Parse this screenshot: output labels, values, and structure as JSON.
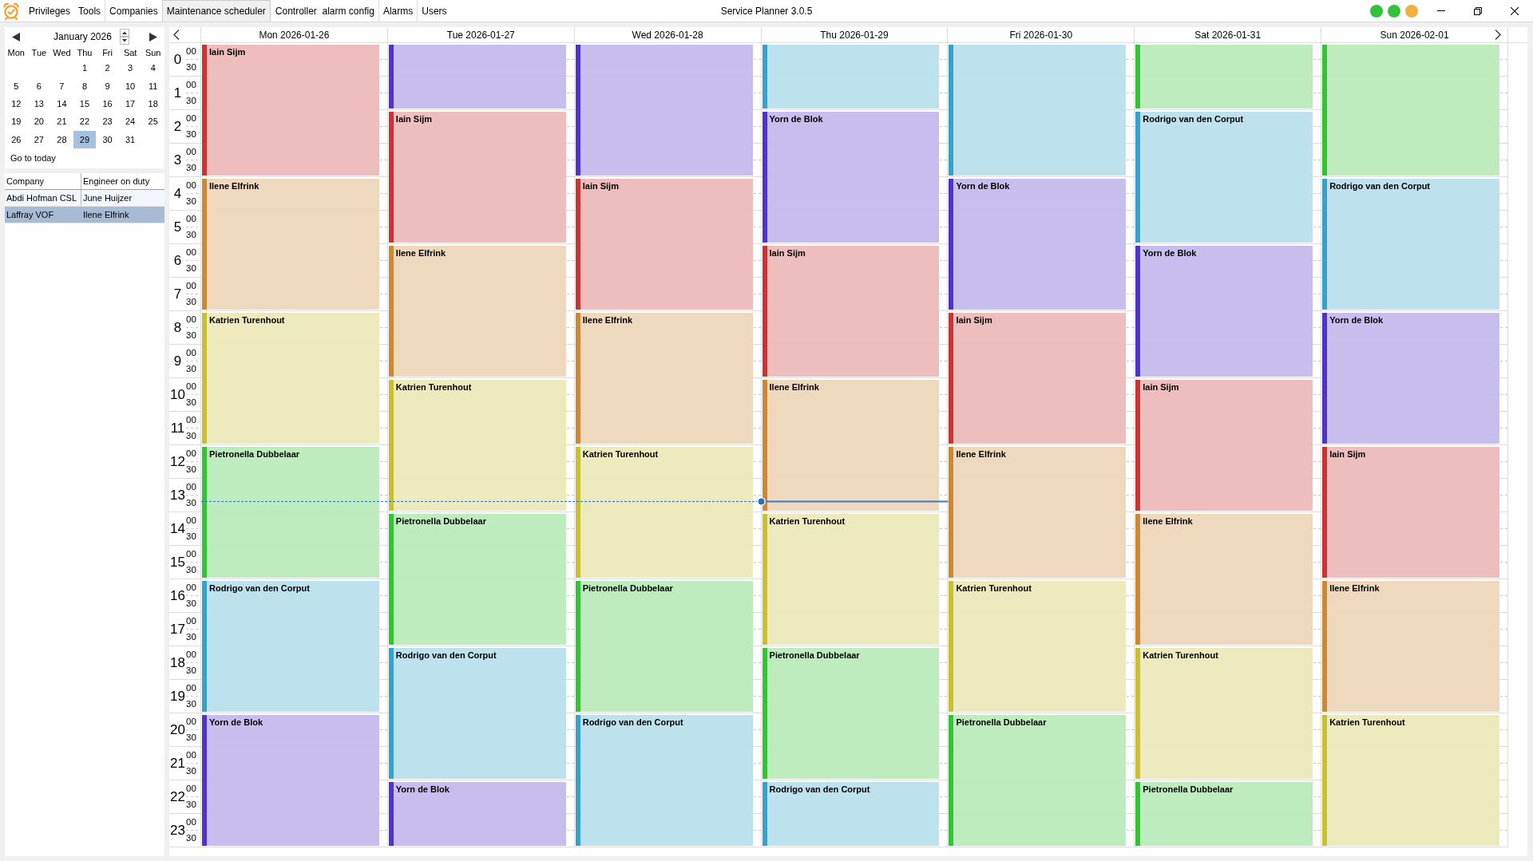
{
  "app": {
    "menu": [
      "Privileges",
      "Tools"
    ],
    "tabs": [
      {
        "label": "Companies",
        "selected": false
      },
      {
        "label": "Maintenance scheduler",
        "selected": true
      },
      {
        "label": "Controller  alarm config",
        "selected": false
      },
      {
        "label": "Alarms",
        "selected": false
      },
      {
        "label": "Users",
        "selected": false
      }
    ],
    "title": "Service Planner 3.0.5",
    "status_lights": [
      {
        "color": "#34c23e"
      },
      {
        "color": "#34c23e"
      },
      {
        "color": "#f2b040"
      }
    ]
  },
  "mini_calendar": {
    "month": "January 2026",
    "weekdays": [
      "Mon",
      "Tue",
      "Wed",
      "Thu",
      "Fri",
      "Sat",
      "Sun"
    ],
    "weeks": [
      [
        {
          "label": "1",
          "selected": false
        },
        {
          "label": "2",
          "selected": false
        },
        {
          "label": "3",
          "selected": false
        },
        {
          "label": "4",
          "selected": false
        }
      ],
      [
        {
          "label": "5",
          "selected": false
        },
        {
          "label": "6",
          "selected": false
        },
        {
          "label": "7",
          "selected": false
        },
        {
          "label": "8",
          "selected": false
        },
        {
          "label": "9",
          "selected": false
        },
        {
          "label": "10",
          "selected": false
        },
        {
          "label": "11",
          "selected": false
        }
      ],
      [
        {
          "label": "12",
          "selected": false
        },
        {
          "label": "13",
          "selected": false
        },
        {
          "label": "14",
          "selected": false
        },
        {
          "label": "15",
          "selected": false
        },
        {
          "label": "16",
          "selected": false
        },
        {
          "label": "17",
          "selected": false
        },
        {
          "label": "18",
          "selected": false
        }
      ],
      [
        {
          "label": "19",
          "selected": false
        },
        {
          "label": "20",
          "selected": false
        },
        {
          "label": "21",
          "selected": false
        },
        {
          "label": "22",
          "selected": false
        },
        {
          "label": "23",
          "selected": false
        },
        {
          "label": "24",
          "selected": false
        },
        {
          "label": "25",
          "selected": false
        }
      ],
      [
        {
          "label": "26",
          "selected": false
        },
        {
          "label": "27",
          "selected": false
        },
        {
          "label": "28",
          "selected": false
        },
        {
          "label": "29",
          "selected": true
        },
        {
          "label": "30",
          "selected": false
        },
        {
          "label": "31",
          "selected": false
        }
      ]
    ],
    "go_to_today": "Go to today"
  },
  "company_table": {
    "columns": [
      "Company",
      "Engineer on duty"
    ],
    "rows": [
      {
        "cells": [
          "Abdi Hofman CSL",
          "June Huijzer"
        ],
        "selected": false
      },
      {
        "cells": [
          "Laffray VOF",
          "Ilene Elfrink"
        ],
        "selected": true
      }
    ]
  },
  "week_view": {
    "hours": [
      {
        "hour": "0",
        "minutes": [
          {
            "label": "00",
            "now": false
          },
          {
            "label": "30",
            "now": false
          }
        ]
      },
      {
        "hour": "1",
        "minutes": [
          {
            "label": "00",
            "now": false
          },
          {
            "label": "30",
            "now": false
          }
        ]
      },
      {
        "hour": "2",
        "minutes": [
          {
            "label": "00",
            "now": false
          },
          {
            "label": "30",
            "now": false
          }
        ]
      },
      {
        "hour": "3",
        "minutes": [
          {
            "label": "00",
            "now": false
          },
          {
            "label": "30",
            "now": false
          }
        ]
      },
      {
        "hour": "4",
        "minutes": [
          {
            "label": "00",
            "now": false
          },
          {
            "label": "30",
            "now": false
          }
        ]
      },
      {
        "hour": "5",
        "minutes": [
          {
            "label": "00",
            "now": false
          },
          {
            "label": "30",
            "now": false
          }
        ]
      },
      {
        "hour": "6",
        "minutes": [
          {
            "label": "00",
            "now": false
          },
          {
            "label": "30",
            "now": false
          }
        ]
      },
      {
        "hour": "7",
        "minutes": [
          {
            "label": "00",
            "now": false
          },
          {
            "label": "30",
            "now": false
          }
        ]
      },
      {
        "hour": "8",
        "minutes": [
          {
            "label": "00",
            "now": false
          },
          {
            "label": "30",
            "now": false
          }
        ]
      },
      {
        "hour": "9",
        "minutes": [
          {
            "label": "00",
            "now": false
          },
          {
            "label": "30",
            "now": false
          }
        ]
      },
      {
        "hour": "10",
        "minutes": [
          {
            "label": "00",
            "now": false
          },
          {
            "label": "30",
            "now": false
          }
        ]
      },
      {
        "hour": "11",
        "minutes": [
          {
            "label": "00",
            "now": false
          },
          {
            "label": "30",
            "now": false
          }
        ]
      },
      {
        "hour": "12",
        "minutes": [
          {
            "label": "00",
            "now": false
          },
          {
            "label": "30",
            "now": false
          }
        ]
      },
      {
        "hour": "13",
        "minutes": [
          {
            "label": "00",
            "now": false
          },
          {
            "label": "30",
            "now": true
          }
        ]
      },
      {
        "hour": "14",
        "minutes": [
          {
            "label": "00",
            "now": false
          },
          {
            "label": "30",
            "now": false
          }
        ]
      },
      {
        "hour": "15",
        "minutes": [
          {
            "label": "00",
            "now": false
          },
          {
            "label": "30",
            "now": false
          }
        ]
      },
      {
        "hour": "16",
        "minutes": [
          {
            "label": "00",
            "now": false
          },
          {
            "label": "30",
            "now": false
          }
        ]
      },
      {
        "hour": "17",
        "minutes": [
          {
            "label": "00",
            "now": false
          },
          {
            "label": "30",
            "now": false
          }
        ]
      },
      {
        "hour": "18",
        "minutes": [
          {
            "label": "00",
            "now": false
          },
          {
            "label": "30",
            "now": false
          }
        ]
      },
      {
        "hour": "19",
        "minutes": [
          {
            "label": "00",
            "now": false
          },
          {
            "label": "30",
            "now": false
          }
        ]
      },
      {
        "hour": "20",
        "minutes": [
          {
            "label": "00",
            "now": false
          },
          {
            "label": "30",
            "now": false
          }
        ]
      },
      {
        "hour": "21",
        "minutes": [
          {
            "label": "00",
            "now": false
          },
          {
            "label": "30",
            "now": false
          }
        ]
      },
      {
        "hour": "22",
        "minutes": [
          {
            "label": "00",
            "now": false
          },
          {
            "label": "30",
            "now": false
          }
        ]
      },
      {
        "hour": "23",
        "minutes": [
          {
            "label": "00",
            "now": false
          },
          {
            "label": "30",
            "now": false
          }
        ]
      }
    ],
    "days": [
      {
        "label": "Mon 2026-01-26",
        "today": false,
        "events": [
          {
            "title": "Iain Sijm",
            "kind": "long",
            "color": "#cc3333"
          },
          {
            "title": "Ilene Elfrink",
            "kind": "long",
            "color": "#cc8833"
          },
          {
            "title": "Katrien Turenhout",
            "kind": "long",
            "color": "#c8c030"
          },
          {
            "title": "Pietronella Dubbelaar",
            "kind": "long",
            "color": "#33c433"
          },
          {
            "title": "Rodrigo van den Corput",
            "kind": "long",
            "color": "#36a2cc"
          },
          {
            "title": "Yorn de Blok",
            "kind": "long",
            "color": "#5033cc"
          }
        ]
      },
      {
        "label": "Tue 2026-01-27",
        "today": false,
        "events": [
          {
            "kind": "short",
            "color": "#5033cc"
          },
          {
            "title": "Iain Sijm",
            "kind": "long",
            "color": "#cc3333"
          },
          {
            "title": "Ilene Elfrink",
            "kind": "long",
            "color": "#cc8833"
          },
          {
            "title": "Katrien Turenhout",
            "kind": "long",
            "color": "#c8c030"
          },
          {
            "title": "Pietronella Dubbelaar",
            "kind": "long",
            "color": "#33c433"
          },
          {
            "title": "Rodrigo van den Corput",
            "kind": "long",
            "color": "#36a2cc"
          },
          {
            "title": "Yorn de Blok",
            "kind": "short",
            "color": "#5033cc"
          }
        ]
      },
      {
        "label": "Wed 2026-01-28",
        "today": false,
        "events": [
          {
            "kind": "long",
            "color": "#5033cc"
          },
          {
            "title": "Iain Sijm",
            "kind": "long",
            "color": "#cc3333"
          },
          {
            "title": "Ilene Elfrink",
            "kind": "long",
            "color": "#cc8833"
          },
          {
            "title": "Katrien Turenhout",
            "kind": "long",
            "color": "#c8c030"
          },
          {
            "title": "Pietronella Dubbelaar",
            "kind": "long",
            "color": "#33c433"
          },
          {
            "title": "Rodrigo van den Corput",
            "kind": "long",
            "color": "#36a2cc"
          }
        ]
      },
      {
        "label": "Thu 2026-01-29",
        "today": true,
        "events": [
          {
            "kind": "short",
            "color": "#36a2cc"
          },
          {
            "title": "Yorn de Blok",
            "kind": "long",
            "color": "#5033cc"
          },
          {
            "title": "Iain Sijm",
            "kind": "long",
            "color": "#cc3333"
          },
          {
            "title": "Ilene Elfrink",
            "kind": "long",
            "color": "#cc8833"
          },
          {
            "title": "Katrien Turenhout",
            "kind": "long",
            "color": "#c8c030"
          },
          {
            "title": "Pietronella Dubbelaar",
            "kind": "long",
            "color": "#33c433"
          },
          {
            "title": "Rodrigo van den Corput",
            "kind": "short",
            "color": "#36a2cc"
          }
        ]
      },
      {
        "label": "Fri 2026-01-30",
        "today": false,
        "events": [
          {
            "kind": "long",
            "color": "#36a2cc"
          },
          {
            "title": "Yorn de Blok",
            "kind": "long",
            "color": "#5033cc"
          },
          {
            "title": "Iain Sijm",
            "kind": "long",
            "color": "#cc3333"
          },
          {
            "title": "Ilene Elfrink",
            "kind": "long",
            "color": "#cc8833"
          },
          {
            "title": "Katrien Turenhout",
            "kind": "long",
            "color": "#c8c030"
          },
          {
            "title": "Pietronella Dubbelaar",
            "kind": "long",
            "color": "#33c433"
          }
        ]
      },
      {
        "label": "Sat 2026-01-31",
        "today": false,
        "events": [
          {
            "kind": "short",
            "color": "#33c433"
          },
          {
            "title": "Rodrigo van den Corput",
            "kind": "long",
            "color": "#36a2cc"
          },
          {
            "title": "Yorn de Blok",
            "kind": "long",
            "color": "#5033cc"
          },
          {
            "title": "Iain Sijm",
            "kind": "long",
            "color": "#cc3333"
          },
          {
            "title": "Ilene Elfrink",
            "kind": "long",
            "color": "#cc8833"
          },
          {
            "title": "Katrien Turenhout",
            "kind": "long",
            "color": "#c8c030"
          },
          {
            "title": "Pietronella Dubbelaar",
            "kind": "short",
            "color": "#33c433"
          }
        ]
      },
      {
        "label": "Sun 2026-02-01",
        "today": false,
        "events": [
          {
            "kind": "long",
            "color": "#33c433"
          },
          {
            "title": "Rodrigo van den Corput",
            "kind": "long",
            "color": "#36a2cc"
          },
          {
            "title": "Yorn de Blok",
            "kind": "long",
            "color": "#5033cc"
          },
          {
            "title": "Iain Sijm",
            "kind": "long",
            "color": "#cc3333"
          },
          {
            "title": "Ilene Elfrink",
            "kind": "long",
            "color": "#cc8833"
          },
          {
            "title": "Katrien Turenhout",
            "kind": "long",
            "color": "#c8c030"
          }
        ]
      }
    ]
  }
}
